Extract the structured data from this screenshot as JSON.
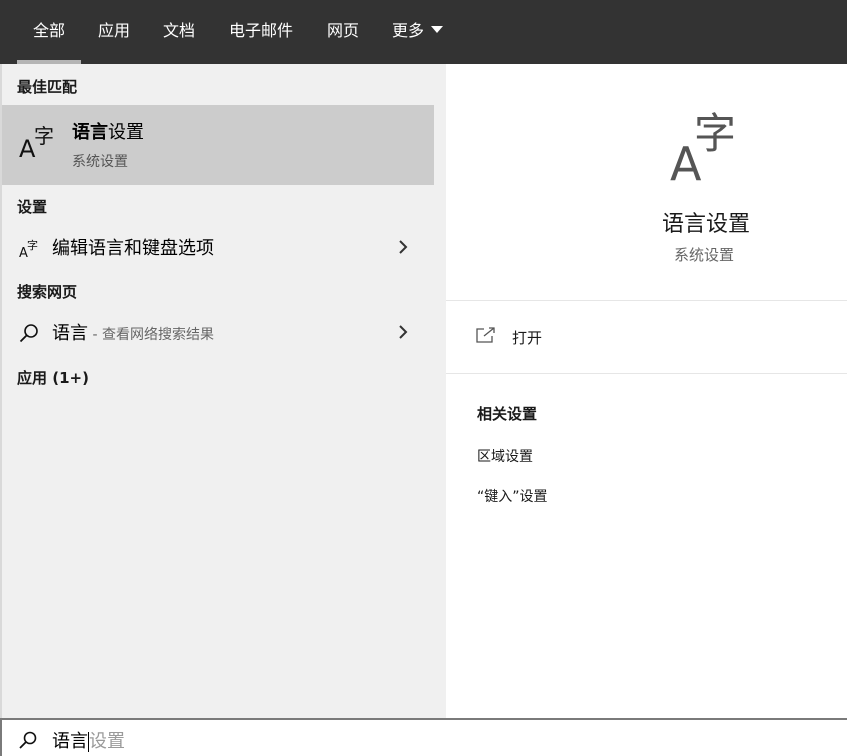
{
  "tabs": [
    {
      "label": "全部",
      "active": true
    },
    {
      "label": "应用",
      "active": false
    },
    {
      "label": "文档",
      "active": false
    },
    {
      "label": "电子邮件",
      "active": false
    },
    {
      "label": "网页",
      "active": false
    },
    {
      "label": "更多",
      "active": false
    }
  ],
  "left": {
    "best_match_label": "最佳匹配",
    "best_match": {
      "title_bold": "语言",
      "title_rest": "设置",
      "subtitle": "系统设置",
      "icon": "language-icon"
    },
    "settings_label": "设置",
    "settings_item": {
      "label": "编辑语言和键盘选项",
      "icon": "language-icon"
    },
    "web_label": "搜索网页",
    "web_item": {
      "label": "语言",
      "hint": " - 查看网络搜索结果",
      "icon": "search-icon"
    },
    "apps_label": "应用 (1+)"
  },
  "preview": {
    "title": "语言设置",
    "subtitle": "系统设置",
    "open_label": "打开",
    "related_title": "相关设置",
    "related_links": [
      "区域设置",
      "“键入”设置"
    ]
  },
  "search": {
    "typed": "语言",
    "suggestion": "设置"
  },
  "colors": {
    "topbar": "#333333",
    "highlight": "#cccccc",
    "pane": "#f0f0f0"
  }
}
